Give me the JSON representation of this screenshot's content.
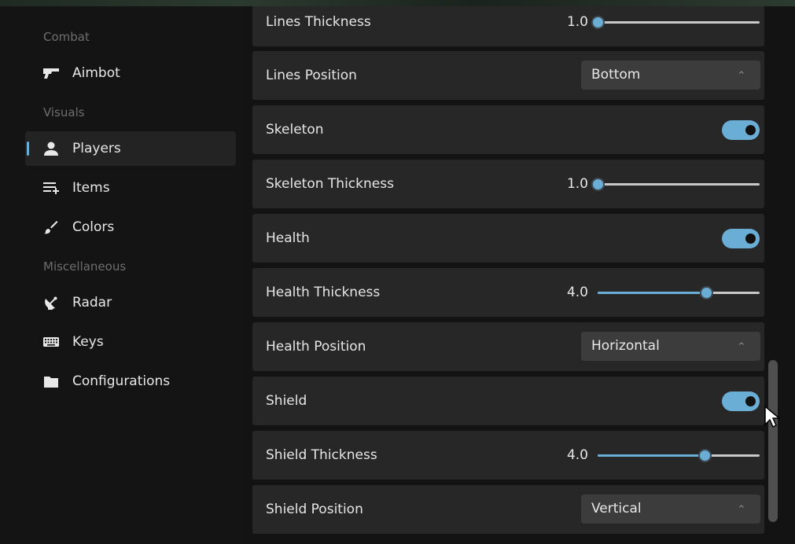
{
  "colors": {
    "accent": "#6aaed6",
    "row_bg": "#262726",
    "sidebar_bg": "#131413"
  },
  "sidebar": {
    "sections": [
      {
        "title": "Combat",
        "items": [
          {
            "label": "Aimbot",
            "icon": "gun-icon",
            "active": false
          }
        ]
      },
      {
        "title": "Visuals",
        "items": [
          {
            "label": "Players",
            "icon": "person-icon",
            "active": true
          },
          {
            "label": "Items",
            "icon": "list-add-icon",
            "active": false
          },
          {
            "label": "Colors",
            "icon": "brush-icon",
            "active": false
          }
        ]
      },
      {
        "title": "Miscellaneous",
        "items": [
          {
            "label": "Radar",
            "icon": "satellite-dish-icon",
            "active": false
          },
          {
            "label": "Keys",
            "icon": "keyboard-icon",
            "active": false
          },
          {
            "label": "Configurations",
            "icon": "folder-icon",
            "active": false
          }
        ]
      }
    ]
  },
  "settings": [
    {
      "type": "slider",
      "label": "Lines Thickness",
      "value_text": "1.0",
      "fraction": 0.0
    },
    {
      "type": "select",
      "label": "Lines Position",
      "value": "Bottom"
    },
    {
      "type": "toggle",
      "label": "Skeleton",
      "on": true
    },
    {
      "type": "slider",
      "label": "Skeleton Thickness",
      "value_text": "1.0",
      "fraction": 0.0
    },
    {
      "type": "toggle",
      "label": "Health",
      "on": true
    },
    {
      "type": "slider",
      "label": "Health Thickness",
      "value_text": "4.0",
      "fraction": 0.67
    },
    {
      "type": "select",
      "label": "Health Position",
      "value": "Horizontal"
    },
    {
      "type": "toggle",
      "label": "Shield",
      "on": true
    },
    {
      "type": "slider",
      "label": "Shield Thickness",
      "value_text": "4.0",
      "fraction": 0.66
    },
    {
      "type": "select",
      "label": "Shield Position",
      "value": "Vertical"
    }
  ],
  "select_chevron": "^"
}
